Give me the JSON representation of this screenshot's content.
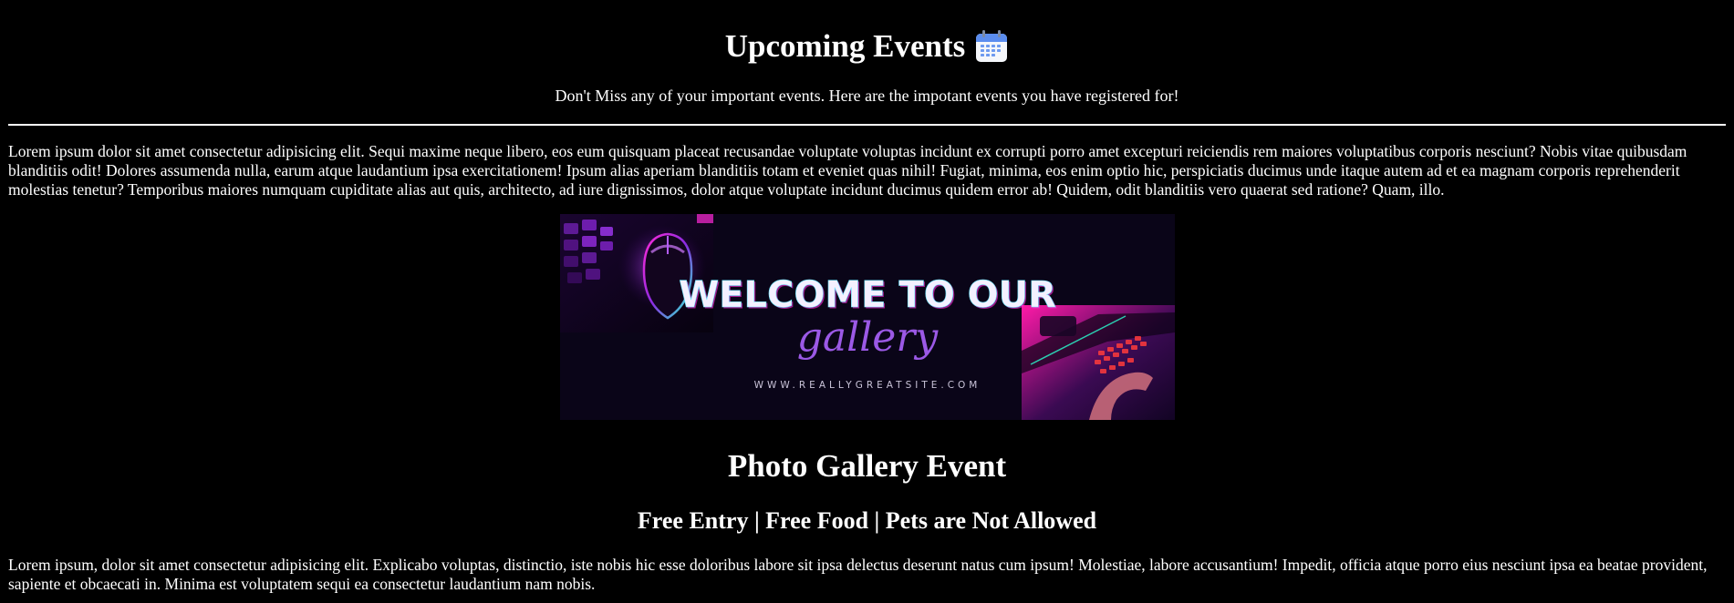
{
  "header": {
    "title": "Upcoming Events",
    "icon": "calendar-icon",
    "subtitle": "Don't Miss any of your important events. Here are the impotant events you have registered for!"
  },
  "intro": {
    "text": "Lorem ipsum dolor sit amet consectetur adipisicing elit. Sequi maxime neque libero, eos eum quisquam placeat recusandae voluptate voluptas incidunt ex corrupti porro amet excepturi reiciendis rem maiores voluptatibus corporis nesciunt? Nobis vitae quibusdam blanditiis odit! Dolores assumenda nulla, earum atque laudantium ipsa exercitationem! Ipsum alias aperiam blanditiis totam et eveniet quas nihil! Fugiat, minima, eos enim optio hic, perspiciatis ducimus unde itaque autem ad et ea magnam corporis reprehenderit molestias tenetur? Temporibus maiores numquam cupiditate alias aut quis, architecto, ad iure dignissimos, dolor atque voluptate incidunt ducimus quidem error ab! Quidem, odit blanditiis vero quaerat sed ratione? Quam, illo."
  },
  "banner": {
    "line1": "WELCOME TO OUR",
    "line2": "gallery",
    "url": "WWW.REALLYGREATSITE.COM"
  },
  "event": {
    "title": "Photo Gallery Event",
    "tagline": "Free Entry | Free Food | Pets are Not Allowed",
    "text": "Lorem ipsum, dolor sit amet consectetur adipisicing elit. Explicabo voluptas, distinctio, iste nobis hic esse doloribus labore sit ipsa delectus deserunt natus cum ipsum! Molestiae, labore accusantium! Impedit, officia atque porro eius nesciunt ipsa ea beatae provident, sapiente et obcaecati in. Minima est voluptatem sequi ea consectetur laudantium nam nobis."
  },
  "colors": {
    "background": "#000000",
    "text": "#ffffff",
    "banner_bg": "#0a0518",
    "neon_purple": "#8a2be2",
    "neon_pink": "#ff2bd6"
  }
}
